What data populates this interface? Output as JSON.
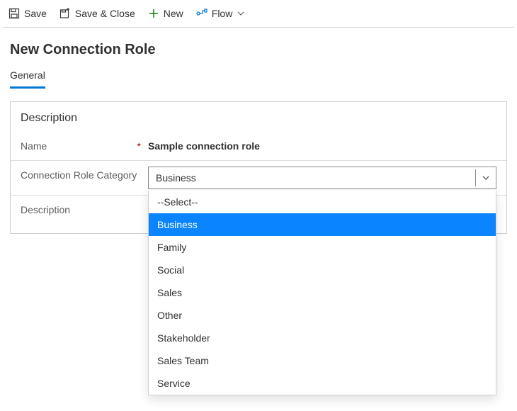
{
  "toolbar": {
    "save": "Save",
    "save_close": "Save & Close",
    "new": "New",
    "flow": "Flow"
  },
  "page_title": "New Connection Role",
  "tabs": {
    "general": "General"
  },
  "section": {
    "title": "Description"
  },
  "form": {
    "name_label": "Name",
    "name_value": "Sample connection role",
    "category_label": "Connection Role Category",
    "category_value": "Business",
    "description_label": "Description",
    "description_value": ""
  },
  "category_options": {
    "o0": "--Select--",
    "o1": "Business",
    "o2": "Family",
    "o3": "Social",
    "o4": "Sales",
    "o5": "Other",
    "o6": "Stakeholder",
    "o7": "Sales Team",
    "o8": "Service"
  },
  "colors": {
    "accent": "#0078d4",
    "highlight": "#0a84ff"
  }
}
